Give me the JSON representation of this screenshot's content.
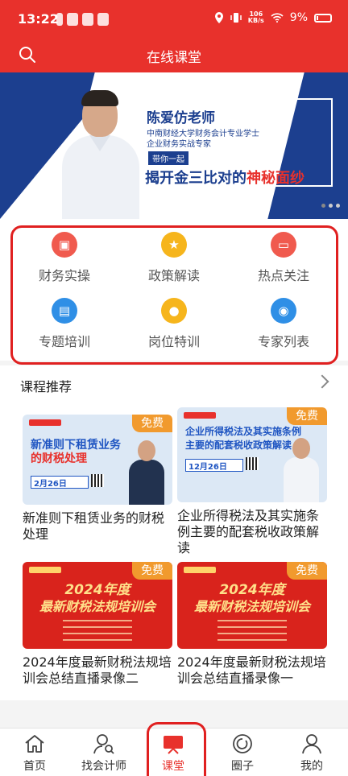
{
  "status_bar": {
    "time": "13:22",
    "net_speed_top": "106",
    "net_speed_bottom": "KB/s",
    "battery": "9%"
  },
  "header": {
    "title": "在线课堂"
  },
  "banner": {
    "teacher": "陈爱仿老师",
    "subtitle_1": "中南财经大学财务会计专业学士",
    "subtitle_2": "企业财务实战专家",
    "tag": "带你一起",
    "headline_blue": "揭开金三比对的",
    "headline_red": "神秘面纱"
  },
  "categories": [
    {
      "label": "财务实操",
      "icon": "wallet-icon",
      "color": "#f05a4e"
    },
    {
      "label": "政策解读",
      "icon": "star-icon",
      "color": "#f6b51c"
    },
    {
      "label": "热点关注",
      "icon": "monitor-icon",
      "color": "#f05a4e"
    },
    {
      "label": "专题培训",
      "icon": "book-icon",
      "color": "#2f8fe6"
    },
    {
      "label": "岗位特训",
      "icon": "person-icon",
      "color": "#f6b51c"
    },
    {
      "label": "专家列表",
      "icon": "expert-icon",
      "color": "#2f8fe6"
    }
  ],
  "recommend": {
    "title": "课程推荐"
  },
  "courses": [
    {
      "badge": "免费",
      "thumb_title_1": "新准则下租赁业务",
      "thumb_title_2": "的财税处理",
      "thumb_date": "2月26日",
      "title": "新准则下租赁业务的财税处理"
    },
    {
      "badge": "免费",
      "thumb_title_1": "企业所得税法及其实施条例",
      "thumb_title_2": "主要的配套税收政策解读",
      "thumb_date": "12月26日",
      "title": "企业所得税法及其实施条例主要的配套税收政策解读"
    },
    {
      "badge": "免费",
      "thumb_year": "2024年度",
      "thumb_event": "最新财税法规培训会",
      "title": "2024年度最新财税法规培训会总结直播录像二"
    },
    {
      "badge": "免费",
      "thumb_year": "2024年度",
      "thumb_event": "最新财税法规培训会",
      "title": "2024年度最新财税法规培训会总结直播录像一"
    }
  ],
  "tabs": [
    {
      "label": "首页",
      "icon": "home-icon"
    },
    {
      "label": "找会计师",
      "icon": "find-accountant-icon"
    },
    {
      "label": "课堂",
      "icon": "classroom-icon",
      "active": true
    },
    {
      "label": "圈子",
      "icon": "circle-icon"
    },
    {
      "label": "我的",
      "icon": "profile-icon"
    }
  ],
  "colors": {
    "brand_red": "#e8312c",
    "banner_blue": "#1c3f8f",
    "free_badge": "#f19a2e"
  }
}
